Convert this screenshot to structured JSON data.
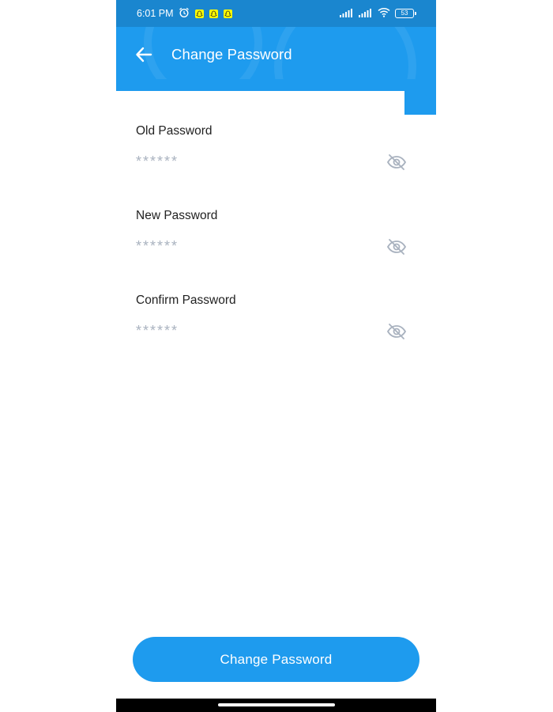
{
  "status_bar": {
    "time": "6:01 PM",
    "battery": "53"
  },
  "header": {
    "title": "Change Password",
    "back_icon": "arrow-left-icon"
  },
  "form": {
    "fields": [
      {
        "label": "Old Password",
        "value": "******",
        "toggle_icon": "eye-off-icon"
      },
      {
        "label": "New Password",
        "value": "******",
        "toggle_icon": "eye-off-icon"
      },
      {
        "label": "Confirm Password",
        "value": "******",
        "toggle_icon": "eye-off-icon"
      }
    ],
    "submit_label": "Change Password"
  },
  "colors": {
    "primary": "#1e9bee",
    "status_bar": "#1a86cf",
    "placeholder": "#a9b2bf",
    "label": "#222222"
  }
}
